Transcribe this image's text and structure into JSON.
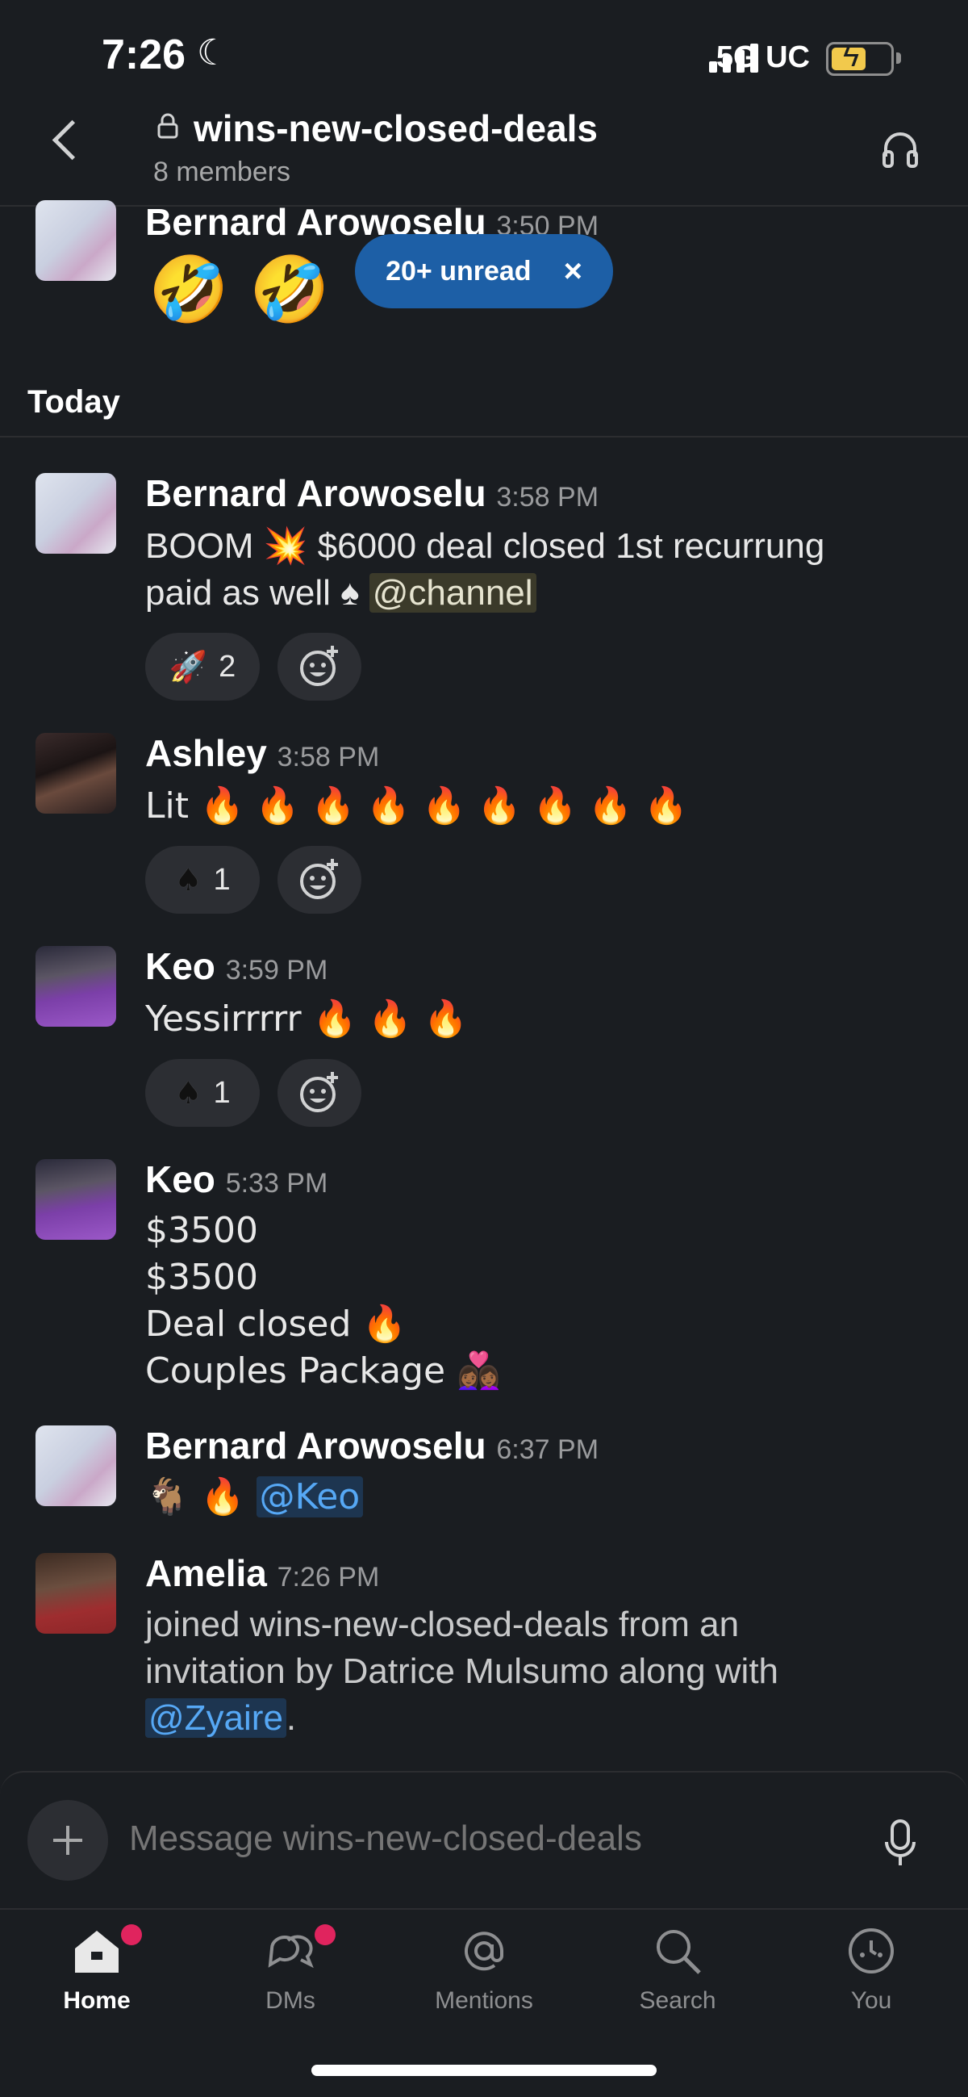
{
  "status_bar": {
    "time": "7:26",
    "network": "5G UC"
  },
  "header": {
    "channel_name": "wins-new-closed-deals",
    "members": "8 members"
  },
  "unread_pill": {
    "label": "20+ unread",
    "close": "×"
  },
  "top_message": {
    "author": "Bernard Arowoselu",
    "time": "3:50 PM",
    "text": "🤣 🤣"
  },
  "day_divider": "Today",
  "messages": [
    {
      "author": "Bernard Arowoselu",
      "time": "3:58 PM",
      "line1": "BOOM 💥 $6000 deal closed 1st recurrung",
      "line2_text": "paid as well ♠ ",
      "mention": "@channel",
      "reaction": {
        "emoji": "🚀",
        "count": "2"
      }
    },
    {
      "author": "Ashley",
      "time": "3:58 PM",
      "text": "Lit 🔥 🔥 🔥 🔥 🔥 🔥 🔥 🔥 🔥",
      "reaction": {
        "emoji": "♠",
        "count": "1"
      }
    },
    {
      "author": "Keo",
      "time": "3:59 PM",
      "text": "Yessirrrrr 🔥 🔥 🔥",
      "reaction": {
        "emoji": "♠",
        "count": "1"
      }
    },
    {
      "author": "Keo",
      "time": "5:33 PM",
      "lines": [
        "$3500",
        "$3500",
        "Deal closed 🔥",
        "Couples Package 👩🏾‍❤️‍👩🏾"
      ]
    },
    {
      "author": "Bernard Arowoselu",
      "time": "6:37 PM",
      "text": "🐐 🔥 ",
      "mention": "@Keo"
    },
    {
      "author": "Amelia",
      "time": "7:26 PM",
      "line1": "joined wins-new-closed-deals from an",
      "line2": "invitation by Datrice Mulsumo along with",
      "mention": "@Zyaire",
      "suffix": "."
    }
  ],
  "composer": {
    "placeholder": "Message wins-new-closed-deals"
  },
  "tabs": [
    {
      "label": "Home",
      "active": true,
      "badge": true
    },
    {
      "label": "DMs",
      "active": false,
      "badge": true
    },
    {
      "label": "Mentions",
      "active": false,
      "badge": false
    },
    {
      "label": "Search",
      "active": false,
      "badge": false
    },
    {
      "label": "You",
      "active": false,
      "badge": false
    }
  ],
  "colors": {
    "background": "#1a1d21",
    "unread_pill": "#1d5fa6",
    "badge": "#e0245e",
    "mention": "#56a8f5"
  }
}
